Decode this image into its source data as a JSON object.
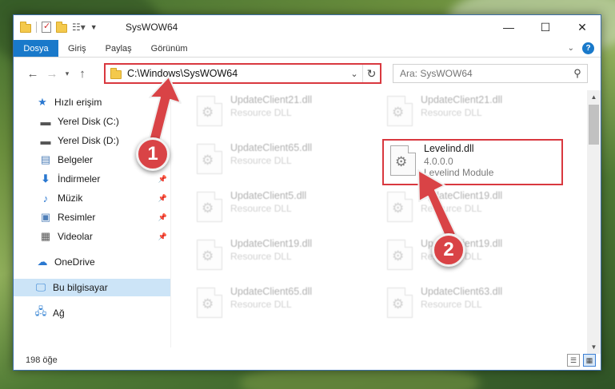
{
  "window": {
    "title": "SysWOW64"
  },
  "ribbon": {
    "tabs": [
      "Dosya",
      "Giriş",
      "Paylaş",
      "Görünüm"
    ]
  },
  "address": {
    "path": "C:\\Windows\\SysWOW64"
  },
  "search": {
    "placeholder": "Ara: SysWOW64"
  },
  "sidebar": {
    "items": [
      {
        "label": "Hızlı erişim",
        "icon": "star-icon"
      },
      {
        "label": "Yerel Disk (C:)",
        "icon": "drive-icon"
      },
      {
        "label": "Yerel Disk (D:)",
        "icon": "drive-icon"
      },
      {
        "label": "Belgeler",
        "icon": "documents-icon"
      },
      {
        "label": "İndirmeler",
        "icon": "download-icon"
      },
      {
        "label": "Müzik",
        "icon": "music-icon"
      },
      {
        "label": "Resimler",
        "icon": "pictures-icon"
      },
      {
        "label": "Videolar",
        "icon": "video-icon"
      },
      {
        "label": "OneDrive",
        "icon": "cloud-icon"
      },
      {
        "label": "Bu bilgisayar",
        "icon": "computer-icon"
      },
      {
        "label": "Ağ",
        "icon": "network-icon"
      }
    ]
  },
  "files": [
    {
      "name": "UpdateClient21.dll",
      "sub": "Resource DLL"
    },
    {
      "name": "UpdateClient21.dll",
      "sub": "Resource DLL"
    },
    {
      "name": "UpdateClient65.dll",
      "sub": "Resource DLL"
    },
    {
      "name": "Levelind.dll",
      "version": "4.0.0.0",
      "sub": "Levelind Module"
    },
    {
      "name": "UpdateClient5.dll",
      "sub": "Resource DLL"
    },
    {
      "name": "UpdateClient19.dll",
      "sub": "Resource DLL"
    },
    {
      "name": "UpdateClient19.dll",
      "sub": "Resource DLL"
    },
    {
      "name": "UpdateClient19.dll",
      "sub": "Resource DLL"
    },
    {
      "name": "UpdateClient65.dll",
      "sub": "Resource DLL"
    },
    {
      "name": "UpdateClient63.dll",
      "sub": "Resource DLL"
    }
  ],
  "status": {
    "count": "198 öğe"
  },
  "callouts": [
    "1",
    "2"
  ],
  "colors": {
    "accent": "#1979ca",
    "highlight": "#d9383f",
    "callout": "#d94346"
  }
}
